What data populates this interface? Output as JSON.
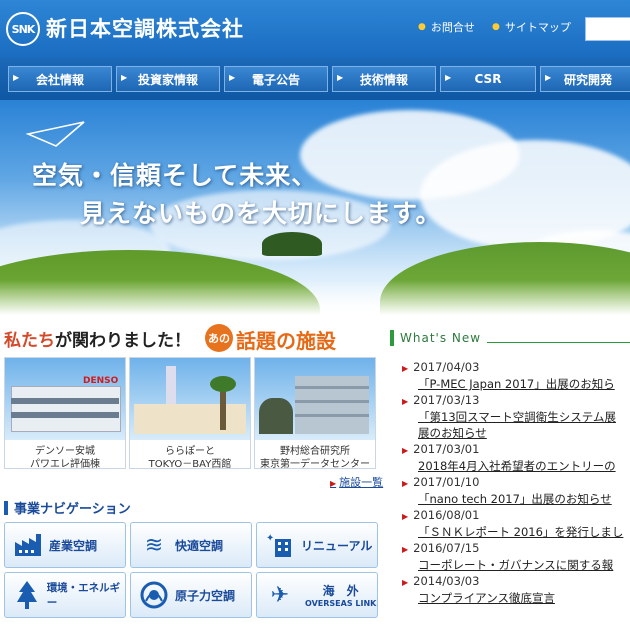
{
  "header": {
    "logo_badge": "SNK",
    "company_name": "新日本空調株式会社",
    "links": [
      {
        "label": "お問合せ"
      },
      {
        "label": "サイトマップ"
      }
    ]
  },
  "nav": {
    "items": [
      {
        "label": "会社情報"
      },
      {
        "label": "投資家情報"
      },
      {
        "label": "電子公告"
      },
      {
        "label": "技術情報"
      },
      {
        "label": "CSR"
      },
      {
        "label": "研究開発"
      }
    ]
  },
  "hero": {
    "line1": "空気・信頼そして未来、",
    "line2": "見えないものを大切にします。"
  },
  "facilities": {
    "title_accent": "私たち",
    "title_rest": "が関わりました！",
    "badge": "あの",
    "title_hot": "話題の施設",
    "cards": [
      {
        "line1": "デンソー安城",
        "line2": "パワエレ評価棟"
      },
      {
        "line1": "ららぽーと",
        "line2": "TOKYO－BAY西館"
      },
      {
        "line1": "野村総合研究所",
        "line2": "東京第一データセンター"
      }
    ],
    "more_label": "施設一覧"
  },
  "business_nav": {
    "title": "事業ナビゲーション",
    "buttons": [
      {
        "label": "産業空調",
        "icon": "factory-icon"
      },
      {
        "label": "快適空調",
        "icon": "wave-icon"
      },
      {
        "label": "リニューアル",
        "icon": "sparkle-building-icon"
      },
      {
        "label": "環境・エネルギー",
        "icon": "tree-icon"
      },
      {
        "label": "原子力空調",
        "icon": "atom-icon"
      },
      {
        "label": "海　外",
        "sublabel": "OVERSEAS LINK",
        "icon": "airplane-icon"
      }
    ]
  },
  "news": {
    "heading": "What's New",
    "items": [
      {
        "date": "2017/04/03",
        "text": "「P-MEC Japan 2017」出展のお知ら"
      },
      {
        "date": "2017/03/13",
        "text": "「第13回スマート空調衛生システム展",
        "text2": "展のお知らせ"
      },
      {
        "date": "2017/03/01",
        "text": "2018年4月入社希望者のエントリーの"
      },
      {
        "date": "2017/01/10",
        "text": "「nano tech 2017」出展のお知らせ"
      },
      {
        "date": "2016/08/01",
        "text": "「ＳＮＫレポート 2016」を発行しまし"
      },
      {
        "date": "2016/07/15",
        "text": "コーポレート・ガバナンスに関する報"
      },
      {
        "date": "2014/03/03",
        "text": "コンプライアンス徹底宣言"
      }
    ]
  }
}
